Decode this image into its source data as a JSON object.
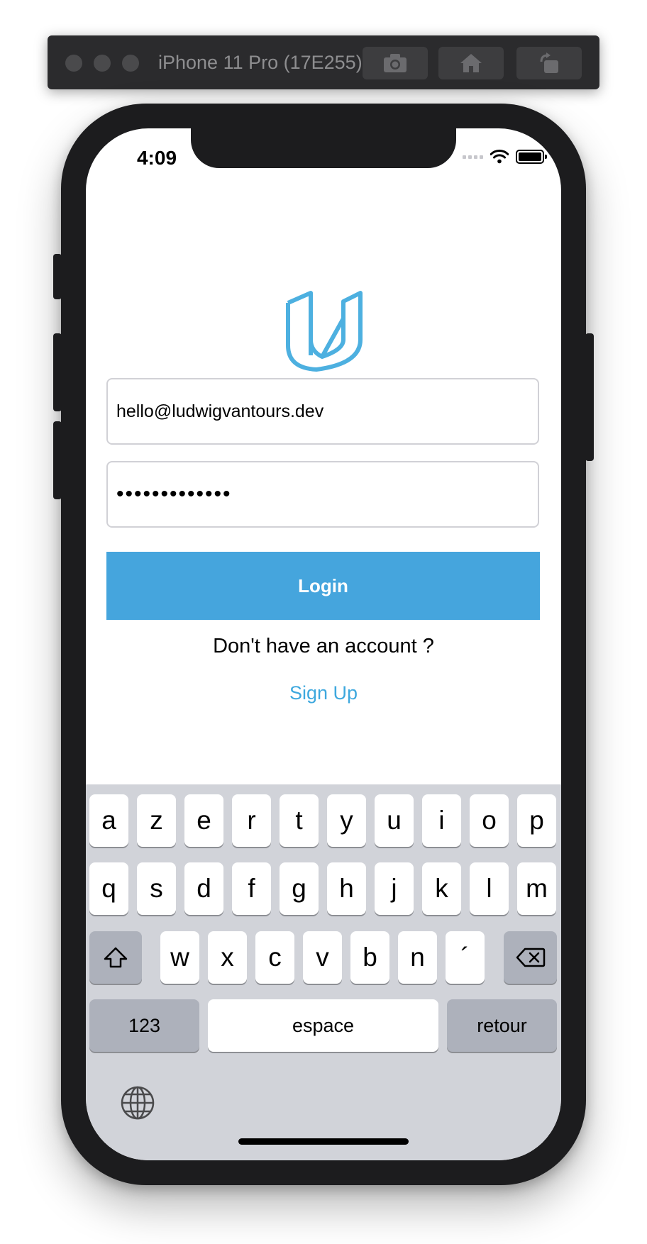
{
  "simulator": {
    "title": "iPhone 11 Pro (17E255)",
    "buttons": [
      "screenshot-icon",
      "home-icon",
      "rotate-icon"
    ]
  },
  "status_bar": {
    "time": "4:09",
    "icons": [
      "cellular-signal-icon",
      "wifi-icon",
      "battery-icon"
    ]
  },
  "brand": {
    "logo_icon": "udacity-logo-icon",
    "color": "#4db0e0"
  },
  "login_form": {
    "email_value": "hello@ludwigvantours.dev",
    "password_value": "•••••••••••••",
    "login_label": "Login",
    "prompt_text": "Don't have an account ?",
    "signup_label": "Sign Up"
  },
  "colors": {
    "accent": "#45a5dd",
    "link": "#3ea8de"
  },
  "keyboard": {
    "row1": [
      "a",
      "z",
      "e",
      "r",
      "t",
      "y",
      "u",
      "i",
      "o",
      "p"
    ],
    "row2": [
      "q",
      "s",
      "d",
      "f",
      "g",
      "h",
      "j",
      "k",
      "l",
      "m"
    ],
    "row3": [
      "w",
      "x",
      "c",
      "v",
      "b",
      "n",
      "´"
    ],
    "numbers_label": "123",
    "space_label": "espace",
    "return_label": "retour",
    "icons": [
      "shift-icon",
      "backspace-icon",
      "globe-icon"
    ]
  }
}
